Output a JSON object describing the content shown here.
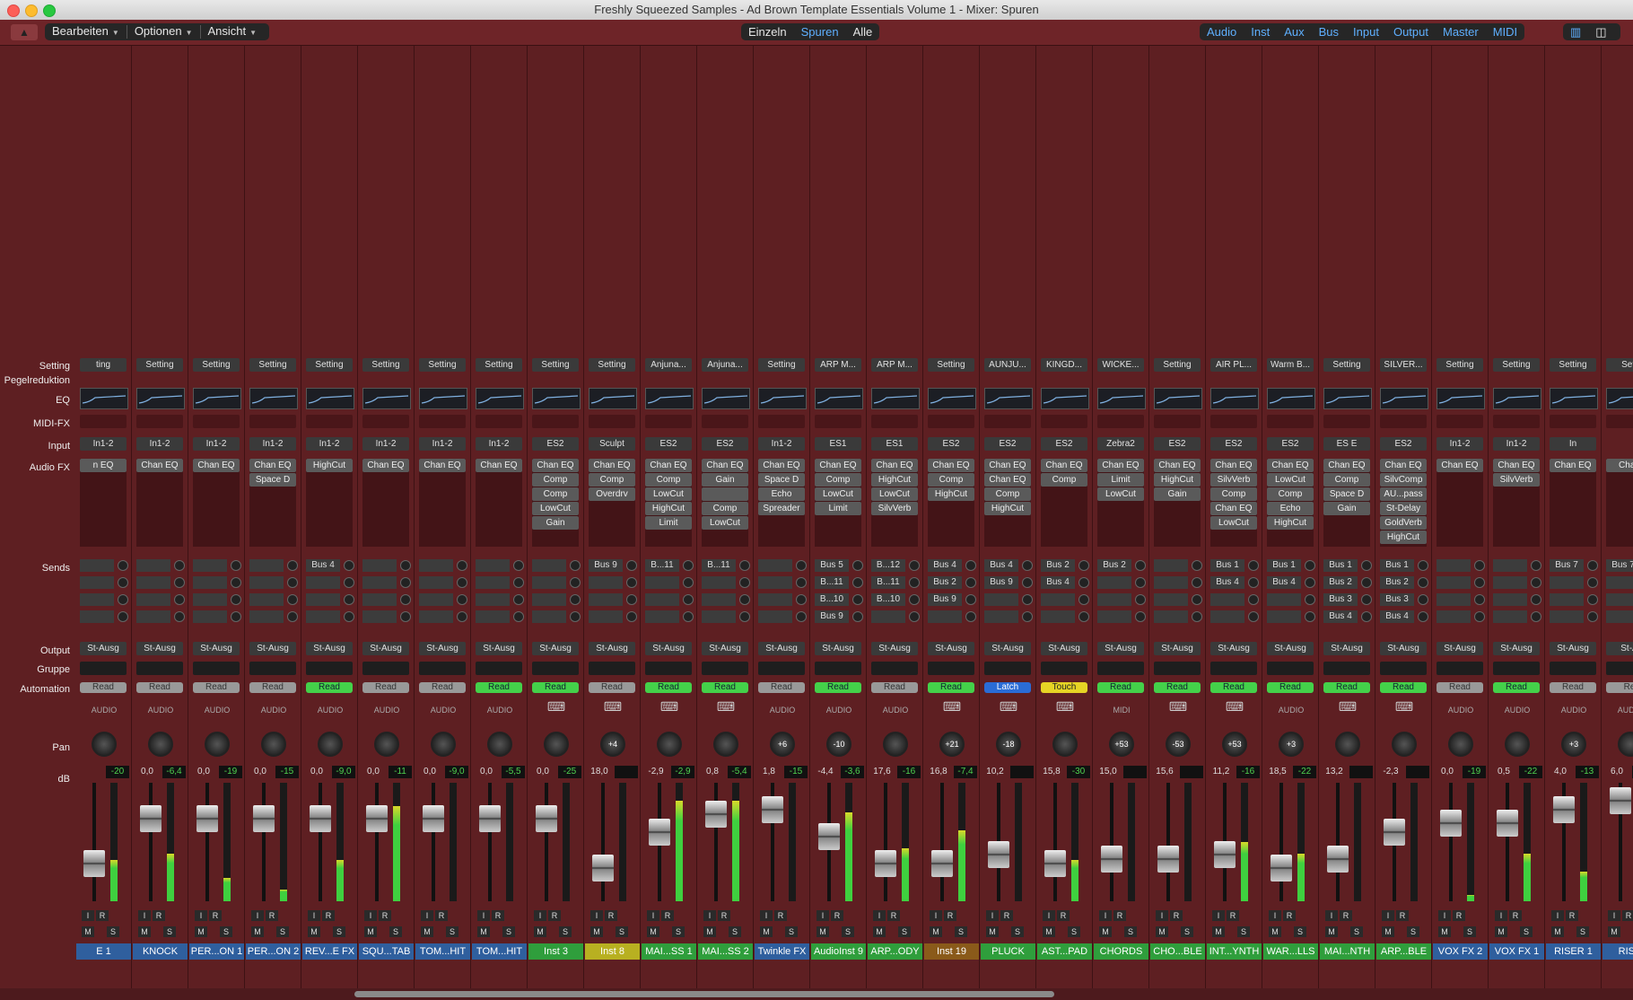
{
  "window_title": "Freshly Squeezed Samples - Ad Brown Template Essentials Volume 1 - Mixer: Spuren",
  "menus": [
    {
      "label": "Bearbeiten"
    },
    {
      "label": "Optionen"
    },
    {
      "label": "Ansicht"
    }
  ],
  "view_modes": [
    {
      "label": "Einzeln",
      "active": false
    },
    {
      "label": "Spuren",
      "active": true
    },
    {
      "label": "Alle",
      "active": false
    }
  ],
  "filters": [
    {
      "label": "Audio"
    },
    {
      "label": "Inst"
    },
    {
      "label": "Aux"
    },
    {
      "label": "Bus"
    },
    {
      "label": "Input"
    },
    {
      "label": "Output"
    },
    {
      "label": "Master"
    },
    {
      "label": "MIDI"
    }
  ],
  "row_labels": {
    "setting": "Setting",
    "gain_reduction": "Pegelreduktion",
    "eq": "EQ",
    "midi_fx": "MIDI-FX",
    "input": "Input",
    "audio_fx": "Audio FX",
    "sends": "Sends",
    "output": "Output",
    "group": "Gruppe",
    "automation": "Automation",
    "pan": "Pan",
    "db": "dB"
  },
  "button_labels": {
    "input_mon": "I",
    "record": "R",
    "mute": "M",
    "solo": "S"
  },
  "colors": {
    "background": "#5e1f22",
    "read_green": "#44d14a",
    "latch_blue": "#2a6cd6",
    "touch_yellow": "#e6d425",
    "name_blue": "#2f5f9e",
    "name_green": "#2f9e3c",
    "name_yellow": "#b8b021",
    "name_brown": "#8a5a1a"
  },
  "strips": [
    {
      "setting": "ting",
      "input": "In1-2",
      "fx": [
        "n EQ"
      ],
      "sends": [],
      "output": "St-Ausg",
      "automation": "Read",
      "auto_style": "grey",
      "type": "AUDIO",
      "pan": "",
      "db1": "",
      "db2": "-20",
      "name": "E 1",
      "name_color": "#2f5f9e",
      "meter": 0.35,
      "fader": 0.25
    },
    {
      "setting": "Setting",
      "input": "In1-2",
      "fx": [
        "Chan EQ"
      ],
      "sends": [],
      "output": "St-Ausg",
      "automation": "Read",
      "auto_style": "grey",
      "type": "AUDIO",
      "pan": "",
      "db1": "0,0",
      "db2": "-6,4",
      "name": "KNOCK",
      "name_color": "#2f5f9e",
      "meter": 0.4,
      "fader": 0.75
    },
    {
      "setting": "Setting",
      "input": "In1-2",
      "fx": [
        "Chan EQ"
      ],
      "sends": [],
      "output": "St-Ausg",
      "automation": "Read",
      "auto_style": "grey",
      "type": "AUDIO",
      "pan": "",
      "db1": "0,0",
      "db2": "-19",
      "name": "PER...ON 1",
      "name_color": "#2f5f9e",
      "meter": 0.2,
      "fader": 0.75
    },
    {
      "setting": "Setting",
      "input": "In1-2",
      "fx": [
        "Chan EQ",
        "Space D"
      ],
      "sends": [],
      "output": "St-Ausg",
      "automation": "Read",
      "auto_style": "grey",
      "type": "AUDIO",
      "pan": "",
      "db1": "0,0",
      "db2": "-15",
      "name": "PER...ON 2",
      "name_color": "#2f5f9e",
      "meter": 0.1,
      "fader": 0.75
    },
    {
      "setting": "Setting",
      "input": "In1-2",
      "fx": [
        "HighCut"
      ],
      "sends": [
        "Bus 4"
      ],
      "output": "St-Ausg",
      "automation": "Read",
      "auto_style": "read",
      "type": "AUDIO",
      "pan": "",
      "db1": "0,0",
      "db2": "-9,0",
      "name": "REV...E FX",
      "name_color": "#2f5f9e",
      "meter": 0.35,
      "fader": 0.75
    },
    {
      "setting": "Setting",
      "input": "In1-2",
      "fx": [
        "Chan EQ"
      ],
      "sends": [],
      "output": "St-Ausg",
      "automation": "Read",
      "auto_style": "grey",
      "type": "AUDIO",
      "pan": "",
      "db1": "0,0",
      "db2": "-11",
      "name": "SQU...TAB",
      "name_color": "#2f5f9e",
      "meter": 0.8,
      "fader": 0.75
    },
    {
      "setting": "Setting",
      "input": "In1-2",
      "fx": [
        "Chan EQ"
      ],
      "sends": [],
      "output": "St-Ausg",
      "automation": "Read",
      "auto_style": "grey",
      "type": "AUDIO",
      "pan": "",
      "db1": "0,0",
      "db2": "-9,0",
      "name": "TOM...HIT",
      "name_color": "#2f5f9e",
      "meter": 0.0,
      "fader": 0.75
    },
    {
      "setting": "Setting",
      "input": "In1-2",
      "fx": [
        "Chan EQ"
      ],
      "sends": [],
      "output": "St-Ausg",
      "automation": "Read",
      "auto_style": "read",
      "type": "AUDIO",
      "pan": "",
      "db1": "0,0",
      "db2": "-5,5",
      "name": "TOM...HIT",
      "name_color": "#2f5f9e",
      "meter": 0.0,
      "fader": 0.75
    },
    {
      "setting": "Setting",
      "input": "ES2",
      "fx": [
        "Chan EQ",
        "Comp",
        "Comp",
        "LowCut",
        "Gain"
      ],
      "sends": [],
      "output": "St-Ausg",
      "automation": "Read",
      "auto_style": "read",
      "type": "",
      "pan": "",
      "db1": "0,0",
      "db2": "-25",
      "name": "Inst 3",
      "name_color": "#2f9e3c",
      "meter": 0.0,
      "fader": 0.75
    },
    {
      "setting": "Setting",
      "input": "Sculpt",
      "fx": [
        "Chan EQ",
        "Comp",
        "Overdrv"
      ],
      "sends": [
        "Bus 9"
      ],
      "output": "St-Ausg",
      "automation": "Read",
      "auto_style": "grey",
      "type": "",
      "pan": "+4",
      "db1": "18,0",
      "db2": "",
      "name": "Inst 8",
      "name_color": "#b8b021",
      "meter": 0.0,
      "fader": 0.2
    },
    {
      "setting": "Anjuna...",
      "input": "ES2",
      "fx": [
        "Chan EQ",
        "Comp",
        "LowCut",
        "HighCut",
        "Limit"
      ],
      "sends": [
        "B...11"
      ],
      "output": "St-Ausg",
      "automation": "Read",
      "auto_style": "read",
      "type": "",
      "pan": "",
      "db1": "-2,9",
      "db2": "-2,9",
      "name": "MAI...SS 1",
      "name_color": "#2f9e3c",
      "meter": 0.85,
      "fader": 0.6
    },
    {
      "setting": "Anjuna...",
      "input": "ES2",
      "fx": [
        "Chan EQ",
        "Gain",
        "",
        "Comp",
        "LowCut"
      ],
      "sends": [
        "B...11"
      ],
      "output": "St-Ausg",
      "automation": "Read",
      "auto_style": "read",
      "type": "",
      "pan": "",
      "db1": "0,8",
      "db2": "-5,4",
      "name": "MAI...SS 2",
      "name_color": "#2f9e3c",
      "meter": 0.85,
      "fader": 0.8
    },
    {
      "setting": "Setting",
      "input": "In1-2",
      "fx": [
        "Chan EQ",
        "Space D",
        "Echo",
        "Spreader"
      ],
      "sends": [],
      "output": "St-Ausg",
      "automation": "Read",
      "auto_style": "grey",
      "type": "AUDIO",
      "pan": "+6",
      "db1": "1,8",
      "db2": "-15",
      "name": "Twinkle FX",
      "name_color": "#2f5f9e",
      "meter": 0.0,
      "fader": 0.85
    },
    {
      "setting": "ARP M...",
      "input": "ES1",
      "fx": [
        "Chan EQ",
        "Comp",
        "LowCut",
        "Limit"
      ],
      "sends": [
        "Bus 5",
        "B...11",
        "B...10",
        "Bus 9"
      ],
      "output": "St-Ausg",
      "automation": "Read",
      "auto_style": "read",
      "type": "AUDIO",
      "pan": "-10",
      "db1": "-4,4",
      "db2": "-3,6",
      "name": "AudioInst 9",
      "name_color": "#2f9e3c",
      "meter": 0.75,
      "fader": 0.55
    },
    {
      "setting": "ARP M...",
      "input": "ES1",
      "fx": [
        "Chan EQ",
        "HighCut",
        "LowCut",
        "SilvVerb"
      ],
      "sends": [
        "B...12",
        "B...11",
        "B...10"
      ],
      "output": "St-Ausg",
      "automation": "Read",
      "auto_style": "grey",
      "type": "AUDIO",
      "pan": "",
      "db1": "17,6",
      "db2": "-16",
      "name": "ARP...ODY",
      "name_color": "#2f9e3c",
      "meter": 0.45,
      "fader": 0.25
    },
    {
      "setting": "Setting",
      "input": "ES2",
      "fx": [
        "Chan EQ",
        "Comp",
        "HighCut"
      ],
      "sends": [
        "Bus 4",
        "Bus 2",
        "Bus 9"
      ],
      "output": "St-Ausg",
      "automation": "Read",
      "auto_style": "read",
      "type": "",
      "pan": "+21",
      "db1": "16,8",
      "db2": "-7,4",
      "name": "Inst 19",
      "name_color": "#8a5a1a",
      "meter": 0.6,
      "fader": 0.25
    },
    {
      "setting": "AUNJU...",
      "input": "ES2",
      "fx": [
        "Chan EQ",
        "Chan EQ",
        "Comp",
        "HighCut"
      ],
      "sends": [
        "Bus 4",
        "Bus 9"
      ],
      "output": "St-Ausg",
      "automation": "Latch",
      "auto_style": "latch",
      "type": "",
      "pan": "-18",
      "db1": "10,2",
      "db2": "",
      "name": "PLUCK",
      "name_color": "#2f9e3c",
      "meter": 0.0,
      "fader": 0.35
    },
    {
      "setting": "KINGD...",
      "input": "ES2",
      "fx": [
        "Chan EQ",
        "Comp"
      ],
      "sends": [
        "Bus 2",
        "Bus 4"
      ],
      "output": "St-Ausg",
      "automation": "Touch",
      "auto_style": "touch",
      "type": "",
      "pan": "",
      "db1": "15,8",
      "db2": "-30",
      "name": "AST...PAD",
      "name_color": "#2f9e3c",
      "meter": 0.35,
      "fader": 0.25
    },
    {
      "setting": "WICKE...",
      "input": "Zebra2",
      "fx": [
        "Chan EQ",
        "Limit",
        "LowCut"
      ],
      "sends": [
        "Bus 2"
      ],
      "output": "St-Ausg",
      "automation": "Read",
      "auto_style": "read",
      "type": "MIDI",
      "pan": "+53",
      "db1": "15,0",
      "db2": "",
      "name": "CHORDS",
      "name_color": "#2f9e3c",
      "meter": 0.0,
      "fader": 0.3
    },
    {
      "setting": "Setting",
      "input": "ES2",
      "fx": [
        "Chan EQ",
        "HighCut",
        "Gain"
      ],
      "sends": [],
      "output": "St-Ausg",
      "automation": "Read",
      "auto_style": "read",
      "type": "",
      "pan": "-53",
      "db1": "15,6",
      "db2": "",
      "name": "CHO...BLE",
      "name_color": "#2f9e3c",
      "meter": 0.0,
      "fader": 0.3
    },
    {
      "setting": "AIR PL...",
      "input": "ES2",
      "fx": [
        "Chan EQ",
        "SilvVerb",
        "Comp",
        "Chan EQ",
        "LowCut"
      ],
      "sends": [
        "Bus 1",
        "Bus 4"
      ],
      "output": "St-Ausg",
      "automation": "Read",
      "auto_style": "read",
      "type": "",
      "pan": "+53",
      "db1": "11,2",
      "db2": "-16",
      "name": "INT...YNTH",
      "name_color": "#2f9e3c",
      "meter": 0.5,
      "fader": 0.35
    },
    {
      "setting": "Warm B...",
      "input": "ES2",
      "fx": [
        "Chan EQ",
        "LowCut",
        "Comp",
        "Echo",
        "HighCut"
      ],
      "sends": [
        "Bus 1",
        "Bus 4"
      ],
      "output": "St-Ausg",
      "automation": "Read",
      "auto_style": "read",
      "type": "AUDIO",
      "pan": "+3",
      "db1": "18,5",
      "db2": "-22",
      "name": "WAR...LLS",
      "name_color": "#2f9e3c",
      "meter": 0.4,
      "fader": 0.2
    },
    {
      "setting": "Setting",
      "input": "ES E",
      "fx": [
        "Chan EQ",
        "Comp",
        "Space D",
        "Gain"
      ],
      "sends": [
        "Bus 1",
        "Bus 2",
        "Bus 3",
        "Bus 4"
      ],
      "output": "St-Ausg",
      "automation": "Read",
      "auto_style": "read",
      "type": "",
      "pan": "",
      "db1": "13,2",
      "db2": "",
      "name": "MAI...NTH",
      "name_color": "#2f9e3c",
      "meter": 0.0,
      "fader": 0.3
    },
    {
      "setting": "SILVER...",
      "input": "ES2",
      "fx": [
        "Chan EQ",
        "SilvComp",
        "AU...pass",
        "St-Delay",
        "GoldVerb",
        "HighCut"
      ],
      "sends": [
        "Bus 1",
        "Bus 2",
        "Bus 3",
        "Bus 4"
      ],
      "output": "St-Ausg",
      "automation": "Read",
      "auto_style": "read",
      "type": "",
      "pan": "",
      "db1": "-2,3",
      "db2": "",
      "name": "ARP...BLE",
      "name_color": "#2f9e3c",
      "meter": 0.0,
      "fader": 0.6
    },
    {
      "setting": "Setting",
      "input": "In1-2",
      "fx": [
        "Chan EQ"
      ],
      "sends": [],
      "output": "St-Ausg",
      "automation": "Read",
      "auto_style": "grey",
      "type": "AUDIO",
      "pan": "",
      "db1": "0,0",
      "db2": "-19",
      "name": "VOX FX 2",
      "name_color": "#2f5f9e",
      "meter": 0.05,
      "fader": 0.7
    },
    {
      "setting": "Setting",
      "input": "In1-2",
      "fx": [
        "Chan EQ",
        "SilvVerb"
      ],
      "sends": [],
      "output": "St-Ausg",
      "automation": "Read",
      "auto_style": "read",
      "type": "AUDIO",
      "pan": "",
      "db1": "0,5",
      "db2": "-22",
      "name": "VOX FX 1",
      "name_color": "#2f5f9e",
      "meter": 0.4,
      "fader": 0.7
    },
    {
      "setting": "Setting",
      "input": "In",
      "fx": [
        "Chan EQ"
      ],
      "sends": [
        "Bus 7"
      ],
      "output": "St-Ausg",
      "automation": "Read",
      "auto_style": "grey",
      "type": "AUDIO",
      "pan": "+3",
      "db1": "4,0",
      "db2": "-13",
      "name": "RISER 1",
      "name_color": "#2f5f9e",
      "meter": 0.25,
      "fader": 0.85
    },
    {
      "setting": "Sett",
      "input": "",
      "fx": [
        "Chan"
      ],
      "sends": [
        "Bus 7"
      ],
      "output": "St-A",
      "automation": "Re",
      "auto_style": "grey",
      "type": "AUDIO",
      "pan": "",
      "db1": "6,0",
      "db2": "",
      "name": "RISE",
      "name_color": "#2f5f9e",
      "meter": 0.0,
      "fader": 0.95
    }
  ]
}
